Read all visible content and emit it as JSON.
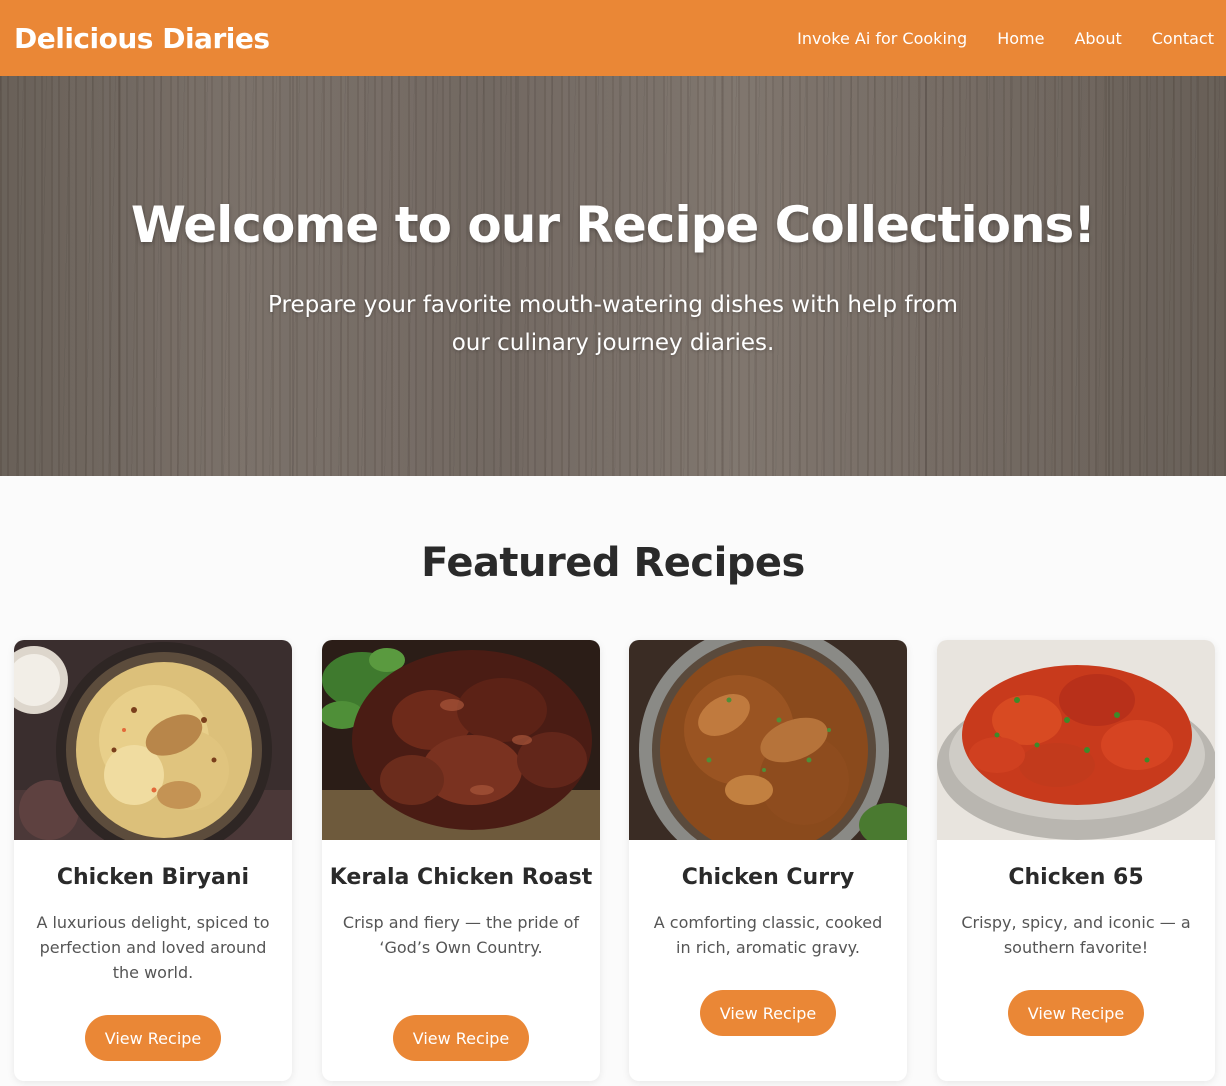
{
  "header": {
    "brand": "Delicious Diaries",
    "nav": [
      {
        "label": "Invoke Ai for Cooking"
      },
      {
        "label": "Home"
      },
      {
        "label": "About"
      },
      {
        "label": "Contact"
      }
    ]
  },
  "hero": {
    "title": "Welcome to our Recipe Collections!",
    "subtitle": "Prepare your favorite mouth-watering dishes with help from our culinary journey diaries."
  },
  "featured": {
    "title": "Featured Recipes",
    "cards": [
      {
        "title": "Chicken Biryani",
        "description": "A luxurious delight, spiced to perfection and loved around the world.",
        "button": "View Recipe"
      },
      {
        "title": "Kerala Chicken Roast",
        "description": "Crisp and fiery — the pride of ‘God’s Own Country.",
        "button": "View Recipe"
      },
      {
        "title": "Chicken Curry",
        "description": "A comforting classic, cooked in rich, aromatic gravy.",
        "button": "View Recipe"
      },
      {
        "title": "Chicken 65",
        "description": "Crispy, spicy, and iconic — a southern favorite!",
        "button": "View Recipe"
      }
    ]
  },
  "colors": {
    "accent": "#ea8736",
    "heading": "#2a2a2a",
    "body_text": "#555555",
    "page_bg": "#fbfbfb"
  }
}
